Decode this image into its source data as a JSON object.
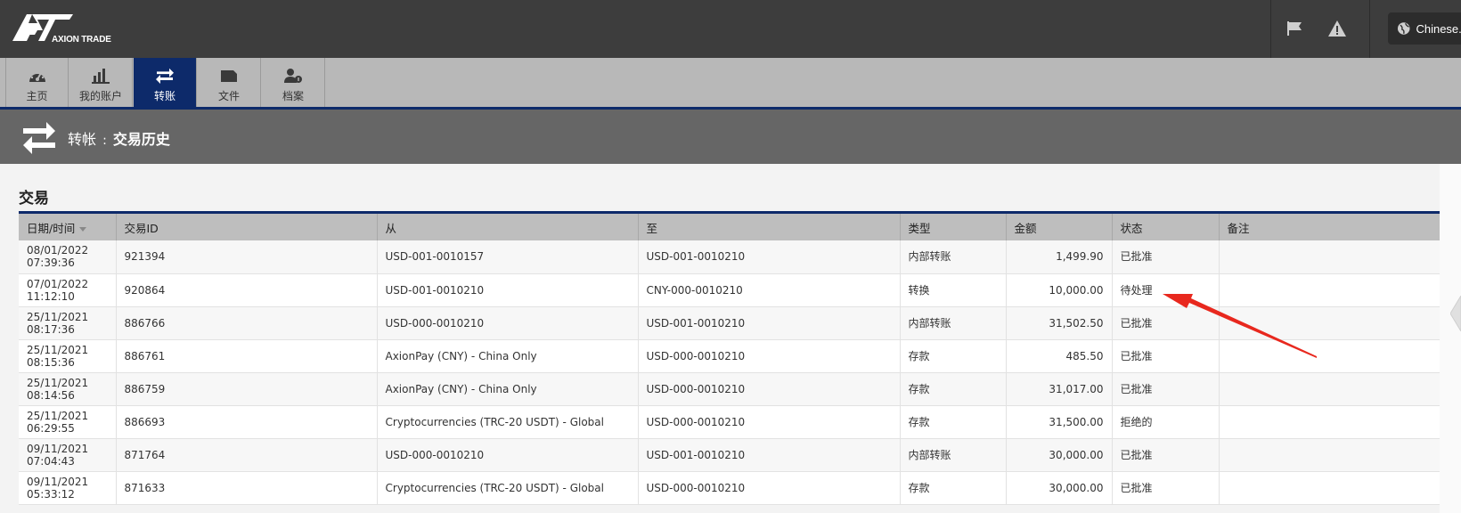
{
  "brand": {
    "name": "AXION TRADE"
  },
  "lang": {
    "label": "Chinese..."
  },
  "nav": {
    "tabs": [
      {
        "label": "主页",
        "icon": "dashboard-icon"
      },
      {
        "label": "我的账户",
        "icon": "bar-chart-icon"
      },
      {
        "label": "转账",
        "icon": "transfer-icon",
        "active": true
      },
      {
        "label": "文件",
        "icon": "folder-icon"
      },
      {
        "label": "档案",
        "icon": "user-profile-icon"
      }
    ]
  },
  "page": {
    "title_prefix": "转帐",
    "separator": ":",
    "title_main": "交易历史"
  },
  "section": {
    "title": "交易"
  },
  "table": {
    "headers": [
      "日期/时间",
      "交易ID",
      "从",
      "至",
      "类型",
      "金额",
      "状态",
      "备注"
    ],
    "rows": [
      {
        "date": "08/01/2022",
        "time": "07:39:36",
        "id": "921394",
        "from": "USD-001-0010157",
        "to": "USD-001-0010210",
        "type": "内部转账",
        "amount": "1,499.90",
        "status": "已批准",
        "note": ""
      },
      {
        "date": "07/01/2022",
        "time": "11:12:10",
        "id": "920864",
        "from": "USD-001-0010210",
        "to": "CNY-000-0010210",
        "type": "转换",
        "amount": "10,000.00",
        "status": "待处理",
        "note": ""
      },
      {
        "date": "25/11/2021",
        "time": "08:17:36",
        "id": "886766",
        "from": "USD-000-0010210",
        "to": "USD-001-0010210",
        "type": "内部转账",
        "amount": "31,502.50",
        "status": "已批准",
        "note": ""
      },
      {
        "date": "25/11/2021",
        "time": "08:15:36",
        "id": "886761",
        "from": "AxionPay (CNY) - China Only",
        "to": "USD-000-0010210",
        "type": "存款",
        "amount": "485.50",
        "status": "已批准",
        "note": ""
      },
      {
        "date": "25/11/2021",
        "time": "08:14:56",
        "id": "886759",
        "from": "AxionPay (CNY) - China Only",
        "to": "USD-000-0010210",
        "type": "存款",
        "amount": "31,017.00",
        "status": "已批准",
        "note": ""
      },
      {
        "date": "25/11/2021",
        "time": "06:29:55",
        "id": "886693",
        "from": "Cryptocurrencies (TRC-20 USDT) - Global",
        "to": "USD-000-0010210",
        "type": "存款",
        "amount": "31,500.00",
        "status": "拒绝的",
        "note": ""
      },
      {
        "date": "09/11/2021",
        "time": "07:04:43",
        "id": "871764",
        "from": "USD-000-0010210",
        "to": "USD-001-0010210",
        "type": "内部转账",
        "amount": "30,000.00",
        "status": "已批准",
        "note": ""
      },
      {
        "date": "09/11/2021",
        "time": "05:33:12",
        "id": "871633",
        "from": "Cryptocurrencies (TRC-20 USDT) - Global",
        "to": "USD-000-0010210",
        "type": "存款",
        "amount": "30,000.00",
        "status": "已批准",
        "note": ""
      }
    ]
  },
  "colors": {
    "accent": "#0d2a6a",
    "annotation": "#e8281e"
  }
}
